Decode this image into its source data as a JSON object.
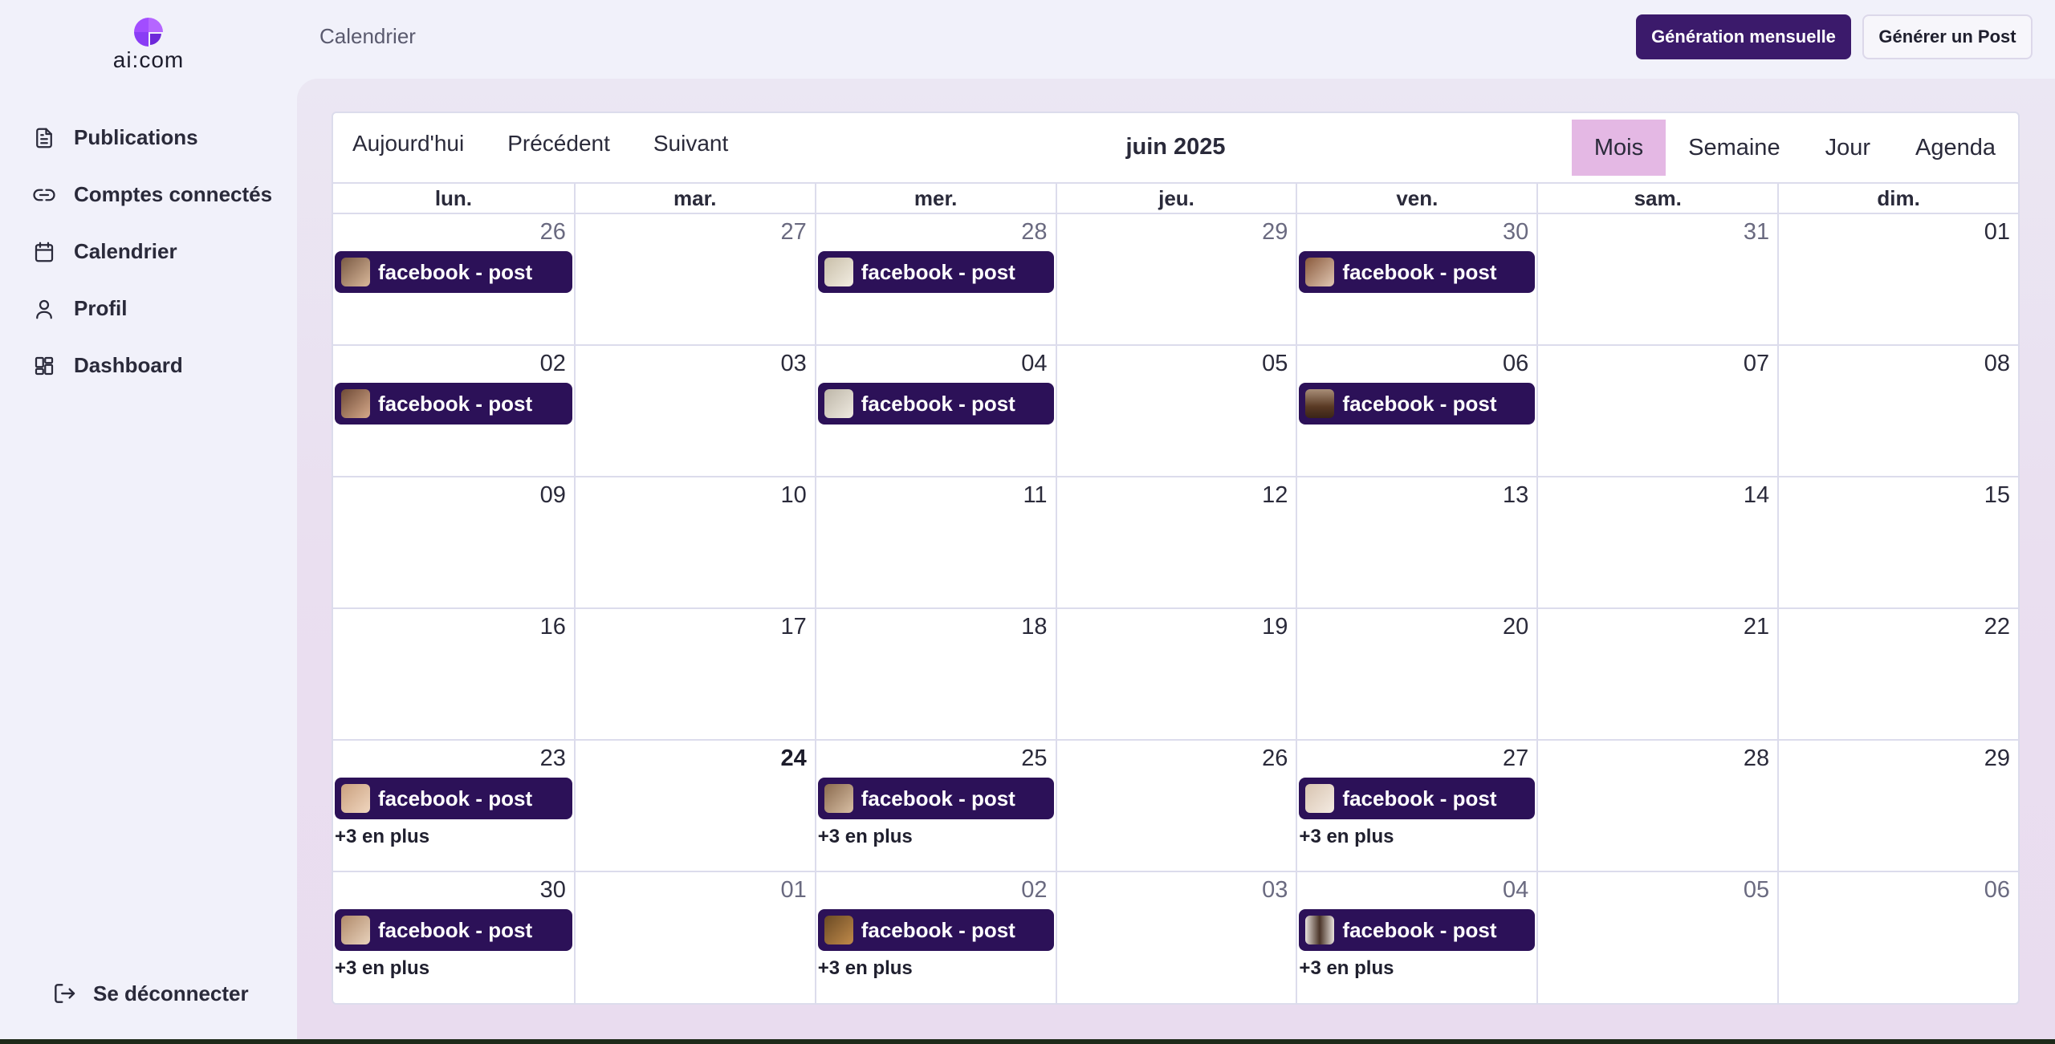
{
  "app": {
    "logo_text": "ai:com"
  },
  "sidebar": {
    "items": [
      {
        "label": "Publications",
        "icon": "document-icon"
      },
      {
        "label": "Comptes connectés",
        "icon": "link-icon"
      },
      {
        "label": "Calendrier",
        "icon": "calendar-icon"
      },
      {
        "label": "Profil",
        "icon": "user-icon"
      },
      {
        "label": "Dashboard",
        "icon": "dashboard-icon"
      }
    ],
    "logout_label": "Se déconnecter"
  },
  "header": {
    "breadcrumb": "Calendrier",
    "primary_button": "Génération mensuelle",
    "secondary_button": "Générer un Post"
  },
  "calendar": {
    "toolbar": {
      "today": "Aujourd'hui",
      "prev": "Précédent",
      "next": "Suivant"
    },
    "title": "juin 2025",
    "views": [
      "Mois",
      "Semaine",
      "Jour",
      "Agenda"
    ],
    "active_view": "Mois",
    "days_of_week": [
      "lun.",
      "mar.",
      "mer.",
      "jeu.",
      "ven.",
      "sam.",
      "dim."
    ],
    "event_label": "facebook - post",
    "more_label": "+3 en plus",
    "weeks": [
      [
        "26",
        "27",
        "28",
        "29",
        "30",
        "31",
        "01"
      ],
      [
        "02",
        "03",
        "04",
        "05",
        "06",
        "07",
        "08"
      ],
      [
        "09",
        "10",
        "11",
        "12",
        "13",
        "14",
        "15"
      ],
      [
        "16",
        "17",
        "18",
        "19",
        "20",
        "21",
        "22"
      ],
      [
        "23",
        "24",
        "25",
        "26",
        "27",
        "28",
        "29"
      ],
      [
        "30",
        "01",
        "02",
        "03",
        "04",
        "05",
        "06"
      ]
    ]
  },
  "colors": {
    "accent": "#3b1a6b",
    "event_bg": "#2c1158",
    "active_view_bg": "#e4b8e4"
  }
}
